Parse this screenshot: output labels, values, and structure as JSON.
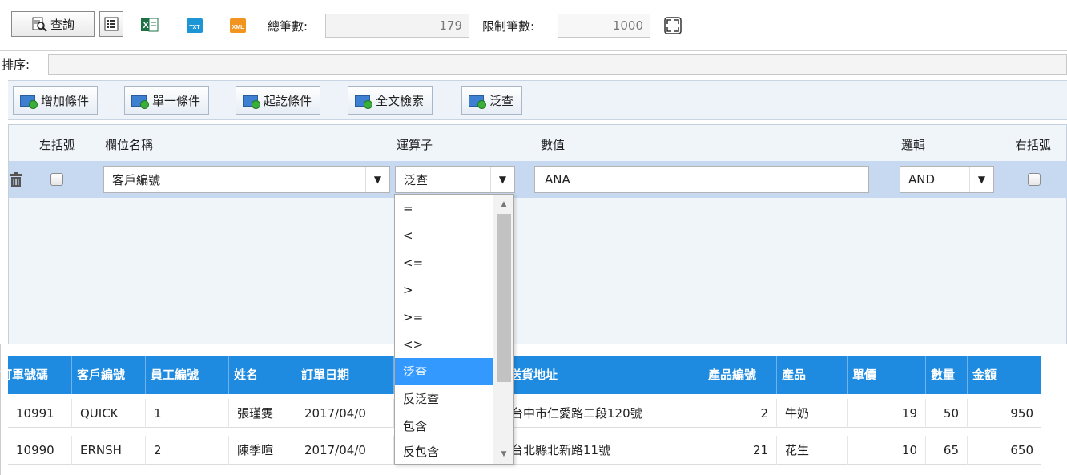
{
  "toolbar": {
    "query_label": "查詢",
    "total_label": "總筆數:",
    "total_value": "179",
    "limit_label": "限制筆數:",
    "limit_value": "1000",
    "icons": [
      "query-icon",
      "list-icon",
      "excel-icon",
      "txt-icon",
      "xml-icon",
      "fullscreen-icon"
    ]
  },
  "sort": {
    "label": "排序:",
    "value": ""
  },
  "condition_bar": {
    "buttons": [
      "增加條件",
      "單一條件",
      "起訖條件",
      "全文檢索",
      "泛查"
    ]
  },
  "filter": {
    "headers": {
      "left_paren": "左括弧",
      "field": "欄位名稱",
      "operator": "運算子",
      "value": "數值",
      "logic": "邏輯",
      "right_paren": "右括弧"
    },
    "row": {
      "field": "客戶編號",
      "operator": "泛查",
      "value": "ANA",
      "logic": "AND"
    },
    "operator_options": [
      "=",
      "<",
      "<=",
      ">",
      ">=",
      "<>",
      "泛查",
      "反泛查",
      "包含",
      "反包含"
    ],
    "selected_operator": "泛查"
  },
  "grid": {
    "columns": [
      "訂單號碼",
      "客戶編號",
      "員工編號",
      "姓名",
      "訂單日期",
      "送貨地址",
      "產品編號",
      "產品",
      "單價",
      "數量",
      "金額"
    ],
    "rows": [
      [
        "10991",
        "QUICK",
        "1",
        "張瑾雯",
        "2017/04/0",
        "台中市仁愛路二段120號",
        "2",
        "牛奶",
        "19",
        "50",
        "950"
      ],
      [
        "10990",
        "ERNSH",
        "2",
        "陳季暄",
        "2017/04/0",
        "台北縣北新路11號",
        "21",
        "花生",
        "10",
        "65",
        "650"
      ]
    ]
  },
  "colors": {
    "header_blue": "#1f8be0",
    "row_highlight": "#c6d9f0",
    "selected_item": "#3399ff"
  }
}
